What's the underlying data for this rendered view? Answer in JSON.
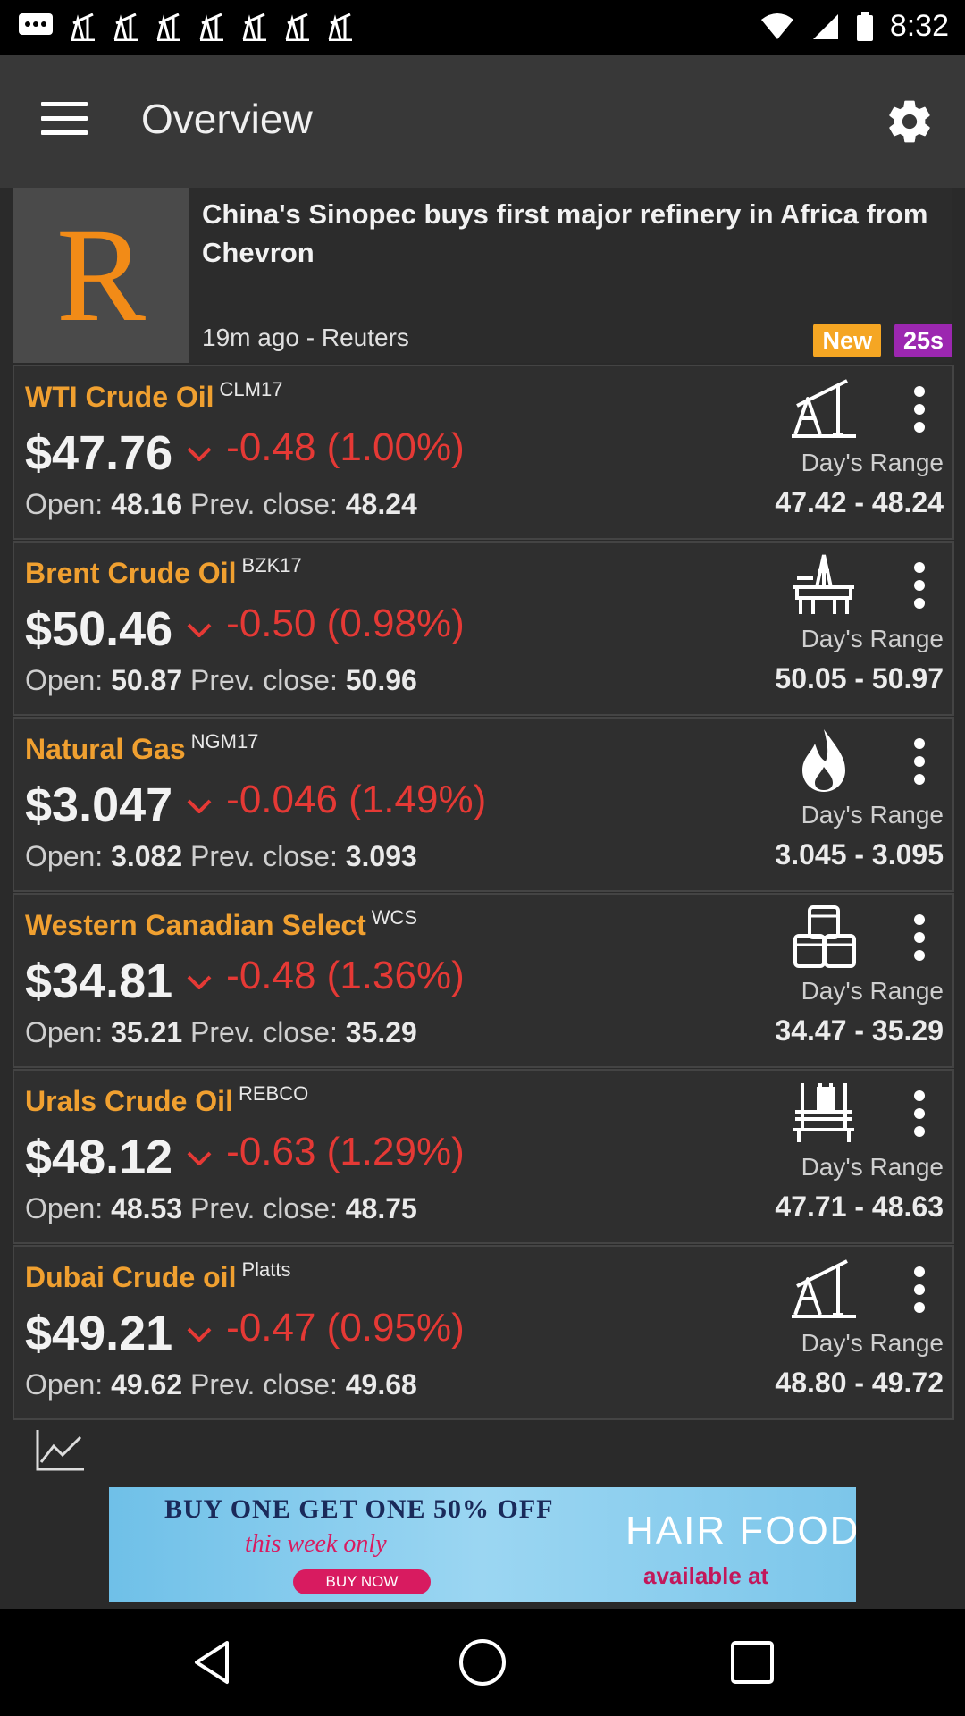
{
  "status_bar": {
    "time": "8:32"
  },
  "app_bar": {
    "title": "Overview"
  },
  "news": {
    "logo_letter": "R",
    "headline": "China's Sinopec buys first major refinery in Africa from Chevron",
    "meta": "19m ago - Reuters",
    "badge_new": "New",
    "badge_age": "25s"
  },
  "commodities": [
    {
      "name": "WTI Crude Oil",
      "symbol": "CLM17",
      "price": "$47.76",
      "change": "-0.48 (1.00%)",
      "open_label": "Open:",
      "open": "48.16",
      "prev_label": "Prev. close:",
      "prev": "48.24",
      "range_label": "Day's Range",
      "range": "47.42 - 48.24",
      "icon": "oil-pump-icon"
    },
    {
      "name": "Brent Crude Oil",
      "symbol": "BZK17",
      "price": "$50.46",
      "change": "-0.50 (0.98%)",
      "open_label": "Open:",
      "open": "50.87",
      "prev_label": "Prev. close:",
      "prev": "50.96",
      "range_label": "Day's Range",
      "range": "50.05 - 50.97",
      "icon": "oil-rig-icon"
    },
    {
      "name": "Natural Gas",
      "symbol": "NGM17",
      "price": "$3.047",
      "change": "-0.046 (1.49%)",
      "open_label": "Open:",
      "open": "3.082",
      "prev_label": "Prev. close:",
      "prev": "3.093",
      "range_label": "Day's Range",
      "range": "3.045 - 3.095",
      "icon": "flame-icon"
    },
    {
      "name": "Western Canadian Select",
      "symbol": "WCS",
      "price": "$34.81",
      "change": "-0.48 (1.36%)",
      "open_label": "Open:",
      "open": "35.21",
      "prev_label": "Prev. close:",
      "prev": "35.29",
      "range_label": "Day's Range",
      "range": "34.47 - 35.29",
      "icon": "barrels-icon"
    },
    {
      "name": "Urals Crude Oil",
      "symbol": "REBCO",
      "price": "$48.12",
      "change": "-0.63 (1.29%)",
      "open_label": "Open:",
      "open": "48.53",
      "prev_label": "Prev. close:",
      "prev": "48.75",
      "range_label": "Day's Range",
      "range": "47.71 - 48.63",
      "icon": "platform-icon"
    },
    {
      "name": "Dubai Crude oil",
      "symbol": "Platts",
      "price": "$49.21",
      "change": "-0.47 (0.95%)",
      "open_label": "Open:",
      "open": "49.62",
      "prev_label": "Prev. close:",
      "prev": "49.68",
      "range_label": "Day's Range",
      "range": "48.80 - 49.72",
      "icon": "oil-pump-icon"
    }
  ],
  "ad": {
    "line1": "BUY ONE GET ONE 50% OFF",
    "line2": "this week only",
    "button": "BUY NOW",
    "brand": "HAIR FOOD",
    "available": "available at"
  },
  "colors": {
    "accent": "#f0a030",
    "negative": "#e53935",
    "badge_new": "#f5a623",
    "badge_age": "#9c27b0"
  }
}
